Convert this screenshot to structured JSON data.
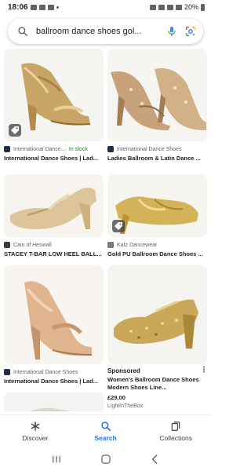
{
  "status_bar": {
    "time": "18:06",
    "battery": "20%"
  },
  "search": {
    "query": "ballroom dance shoes gol..."
  },
  "results": [
    {
      "source": "International Dance...",
      "stock": " · In stock",
      "title": "International Dance Shoes | Lad...",
      "favicon_color": "#1f2f4a",
      "shoe_color": "#c9a467",
      "has_shop_badge": true
    },
    {
      "source": "International Dance Shoes",
      "title": "Ladies Ballroom & Latin Dance ...",
      "favicon_color": "#1f2f4a",
      "shoe_color": "#c7a27a"
    },
    {
      "source": "Cain of Heswall",
      "title": "STACEY T-BAR LOW HEEL BALL...",
      "favicon_color": "#3a3a3a",
      "shoe_color": "#dcc59a"
    },
    {
      "source": "Katz Dancewear",
      "title": "Gold PU Ballroom Dance Shoes ...",
      "favicon_color": "#7a7a7a",
      "shoe_color": "#d4b257",
      "has_shop_badge": true
    },
    {
      "source": "International Dance Shoes",
      "title": "International Dance Shoes | Lad...",
      "favicon_color": "#1f2f4a",
      "shoe_color": "#e0b48f"
    },
    {
      "sponsored": "Sponsored",
      "title": "Women's Ballroom Dance Shoes Modern Shoes Line...",
      "price": "£29.00",
      "seller": "LightInTheBox",
      "shoe_color": "#c9a85a"
    }
  ],
  "bottom_nav": {
    "items": [
      {
        "label": "Discover",
        "icon": "asterisk-icon"
      },
      {
        "label": "Search",
        "icon": "search-icon",
        "active": true
      },
      {
        "label": "Collections",
        "icon": "collections-icon"
      }
    ],
    "active_color": "#1a73e8"
  },
  "system_nav": [
    "recents-icon",
    "home-icon",
    "back-icon"
  ]
}
